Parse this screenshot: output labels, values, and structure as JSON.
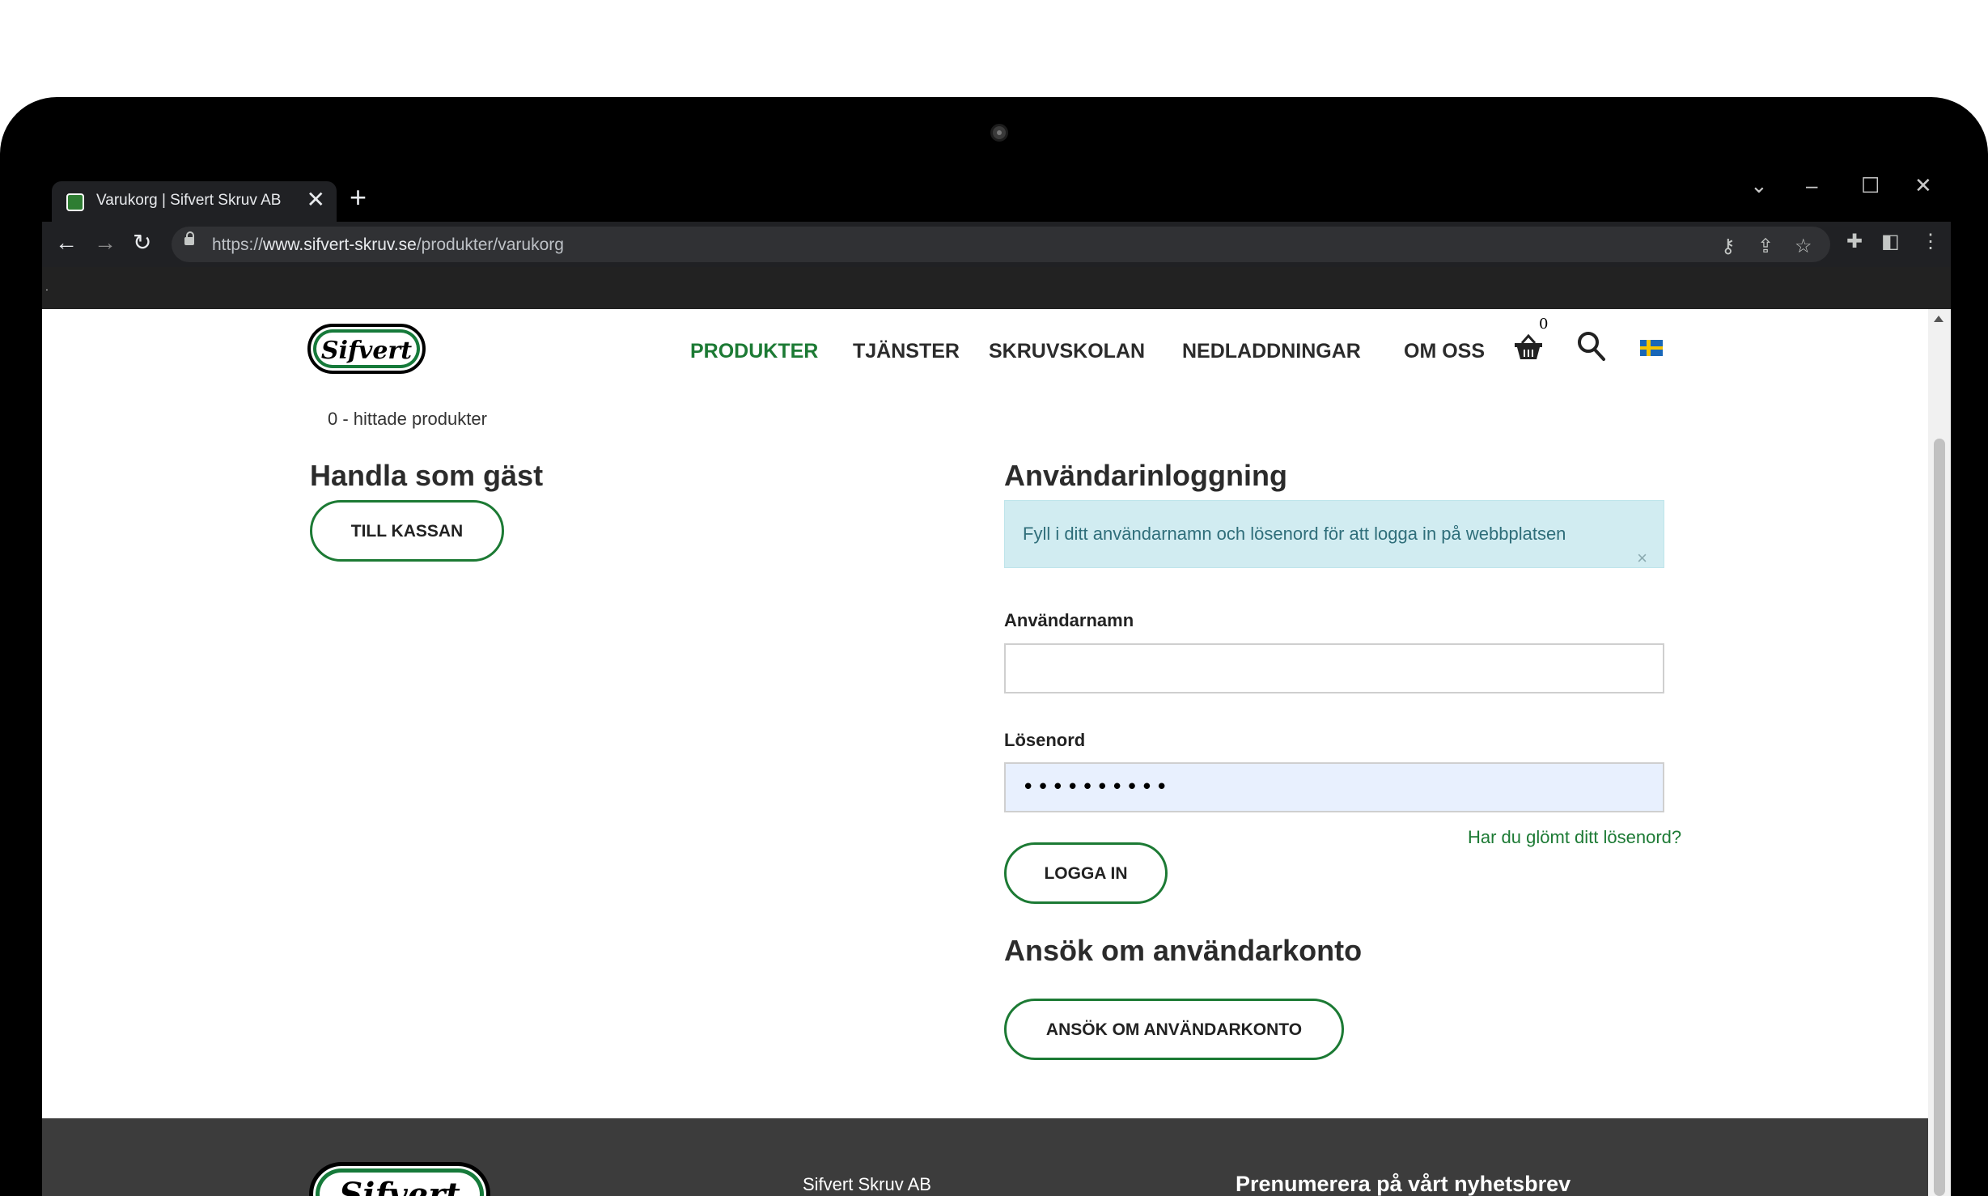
{
  "browser": {
    "tab_title": "Varukorg | Sifvert Skruv AB",
    "tab_close": "✕",
    "new_tab": "+",
    "url_prefix": "https://",
    "url_host": "www.sifvert-skruv.se",
    "url_path": "/produkter/varukorg",
    "controls": {
      "chevron": "⌄",
      "minimize": "–",
      "maximize": "☐",
      "close": "✕"
    },
    "infobar_text": "."
  },
  "site": {
    "logo_text": "Sifvert",
    "nav": [
      {
        "label": "PRODUKTER"
      },
      {
        "label": "TJÄNSTER"
      },
      {
        "label": "SKRUVSKOLAN"
      },
      {
        "label": "NEDLADDNINGAR"
      },
      {
        "label": "OM OSS"
      }
    ],
    "cart_count": "0",
    "icons": {
      "cart": "basket-icon",
      "search": "search-icon",
      "language": "swedish-flag-icon"
    },
    "accent_color": "#1c7a34"
  },
  "cart": {
    "found_text": "0 - hittade produkter"
  },
  "guest": {
    "title": "Handla som gäst",
    "checkout_button": "TILL KASSAN"
  },
  "login": {
    "title": "Användarinloggning",
    "info_message": "Fyll i ditt användarnamn och lösenord för att logga in på webbplatsen",
    "info_close": "×",
    "username_label": "Användarnamn",
    "username_value": "",
    "password_label": "Lösenord",
    "password_value": "••••••••••",
    "login_button": "LOGGA IN",
    "forgot_link": "Har du glömt ditt lösenord?"
  },
  "register": {
    "title": "Ansök om användarkonto",
    "button": "ANSÖK OM ANVÄNDARKONTO"
  },
  "footer": {
    "logo_text": "Sifvert",
    "company": "Sifvert Skruv AB",
    "newsletter_title": "Prenumerera på vårt nyhetsbrev"
  }
}
